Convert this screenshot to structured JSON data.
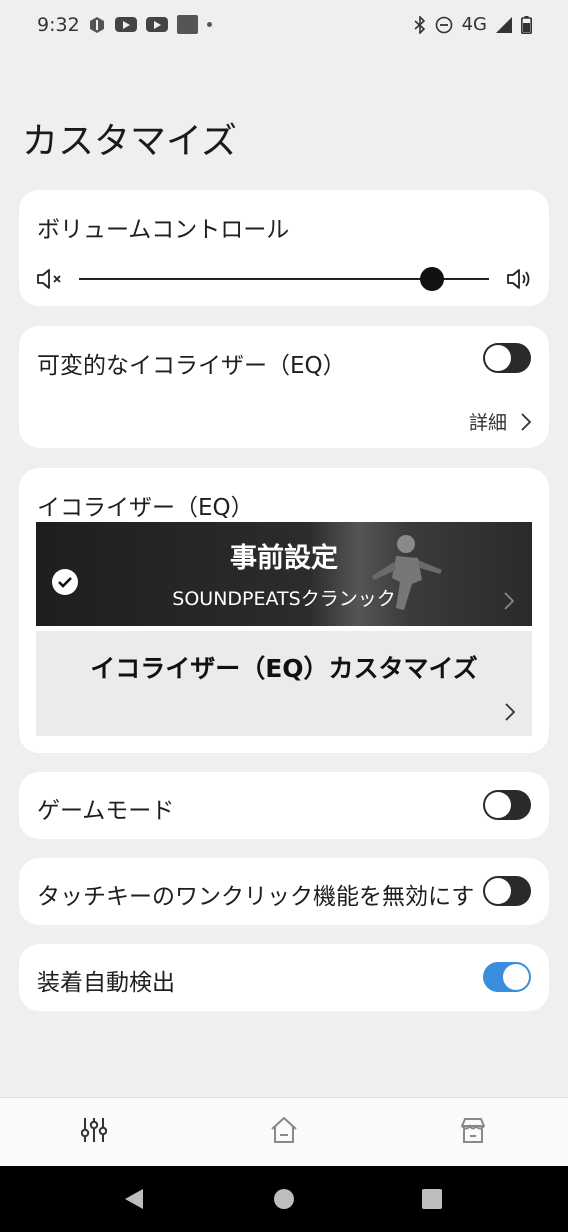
{
  "status_bar": {
    "time": "9:32",
    "network": "4G"
  },
  "page": {
    "title": "カスタマイズ"
  },
  "volume_card": {
    "title": "ボリュームコントロール",
    "volume_fraction": 0.86
  },
  "variable_eq_card": {
    "label": "可変的なイコライザー（EQ）",
    "toggle_on": false,
    "detail_label": "詳細"
  },
  "eq_card": {
    "title": "イコライザー（EQ）",
    "preset": {
      "title": "事前設定",
      "subtitle": "SOUNDPEATSクランック",
      "selected": true
    },
    "custom": {
      "title": "イコライザー（EQ）カスタマイズ"
    }
  },
  "game_mode": {
    "label": "ゲームモード",
    "toggle_on": false
  },
  "touch_key": {
    "label": "タッチキーのワンクリック機能を無効にす",
    "toggle_on": false
  },
  "auto_detect": {
    "label": "装着自動検出",
    "toggle_on": true
  },
  "colors": {
    "accent": "#3a8edb",
    "background": "#efefef",
    "card": "#ffffff"
  },
  "bottom_nav": {
    "items": [
      "equalizer-icon",
      "home-icon",
      "store-icon"
    ]
  }
}
